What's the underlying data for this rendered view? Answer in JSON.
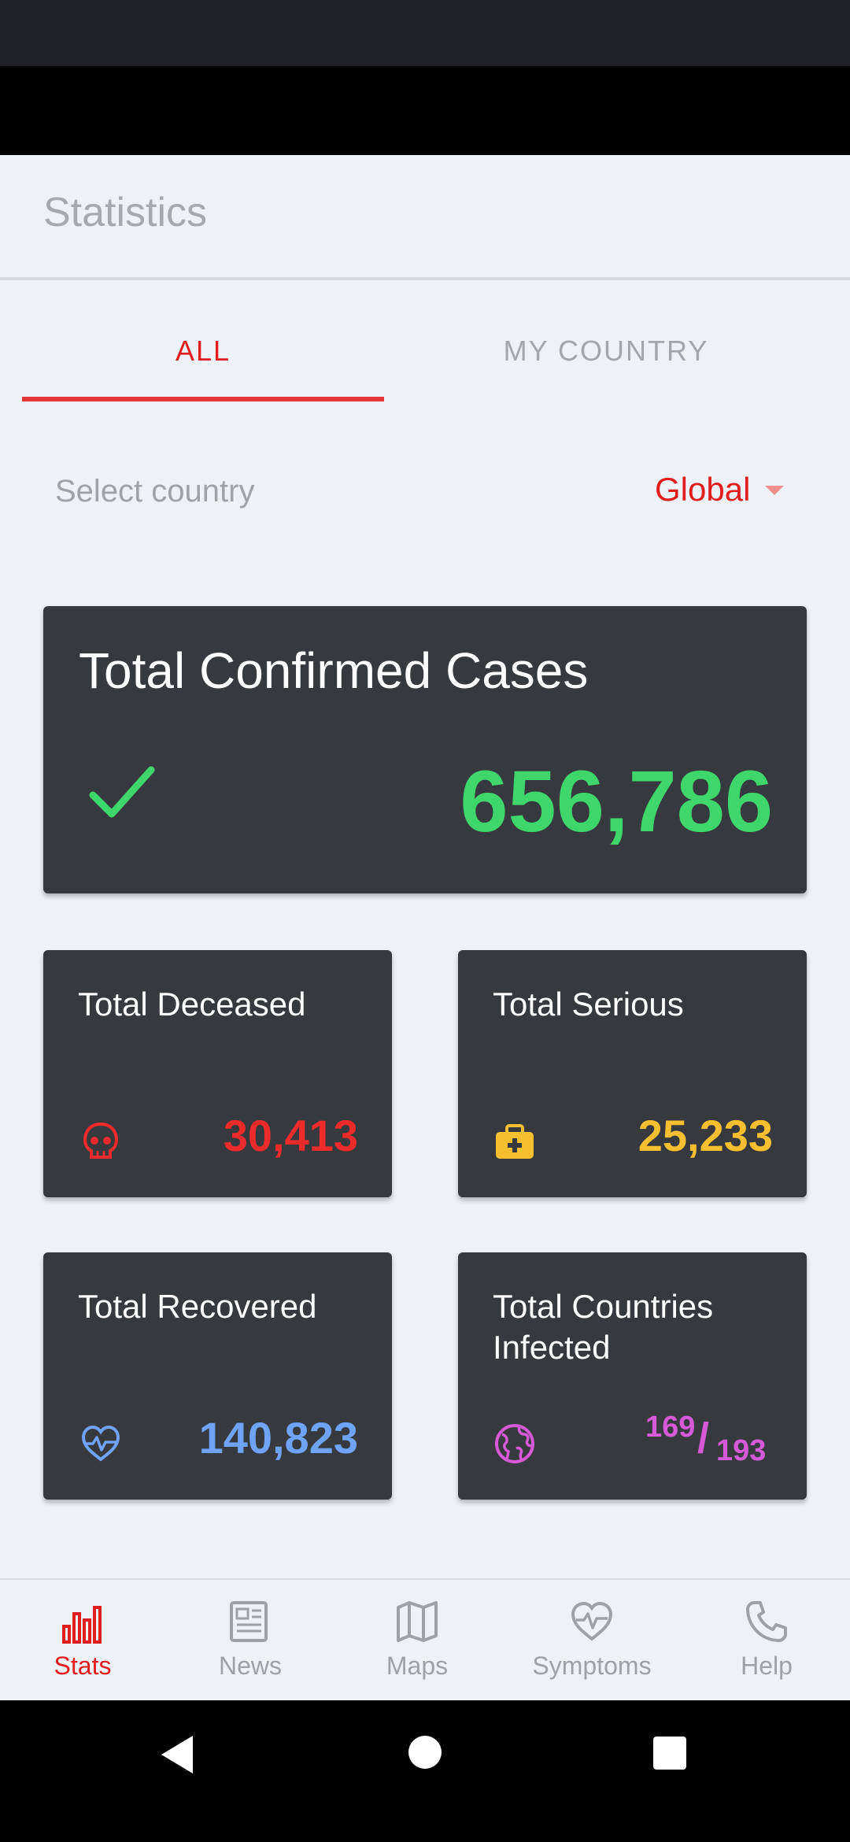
{
  "app": {
    "title": "Statistics"
  },
  "tabs": [
    {
      "label": "ALL",
      "active": true
    },
    {
      "label": "MY COUNTRY",
      "active": false
    }
  ],
  "country_select": {
    "label": "Select country",
    "value": "Global"
  },
  "cards": {
    "confirmed": {
      "title": "Total Confirmed Cases",
      "value": "656,786",
      "icon": "check-icon",
      "color": "#3fd66b"
    },
    "deceased": {
      "title": "Total Deceased",
      "value": "30,413",
      "icon": "skull-icon",
      "color": "#ee2b2b"
    },
    "serious": {
      "title": "Total Serious",
      "value": "25,233",
      "icon": "medical-kit-icon",
      "color": "#f5bf2f"
    },
    "recovered": {
      "title": "Total Recovered",
      "value": "140,823",
      "icon": "heartbeat-icon",
      "color": "#6fa3f6"
    },
    "countries": {
      "title": "Total Countries Infected",
      "infected": "169",
      "total": "193",
      "icon": "globe-icon",
      "color": "#d65ad7"
    }
  },
  "bottom_nav": [
    {
      "label": "Stats",
      "icon": "bar-chart-icon",
      "active": true
    },
    {
      "label": "News",
      "icon": "newspaper-icon",
      "active": false
    },
    {
      "label": "Maps",
      "icon": "map-icon",
      "active": false
    },
    {
      "label": "Symptoms",
      "icon": "heart-pulse-icon",
      "active": false
    },
    {
      "label": "Help",
      "icon": "phone-icon",
      "active": false
    }
  ],
  "colors": {
    "accent": "#e11d1d",
    "card_bg": "#36393d",
    "page_bg": "#eef1f6"
  }
}
